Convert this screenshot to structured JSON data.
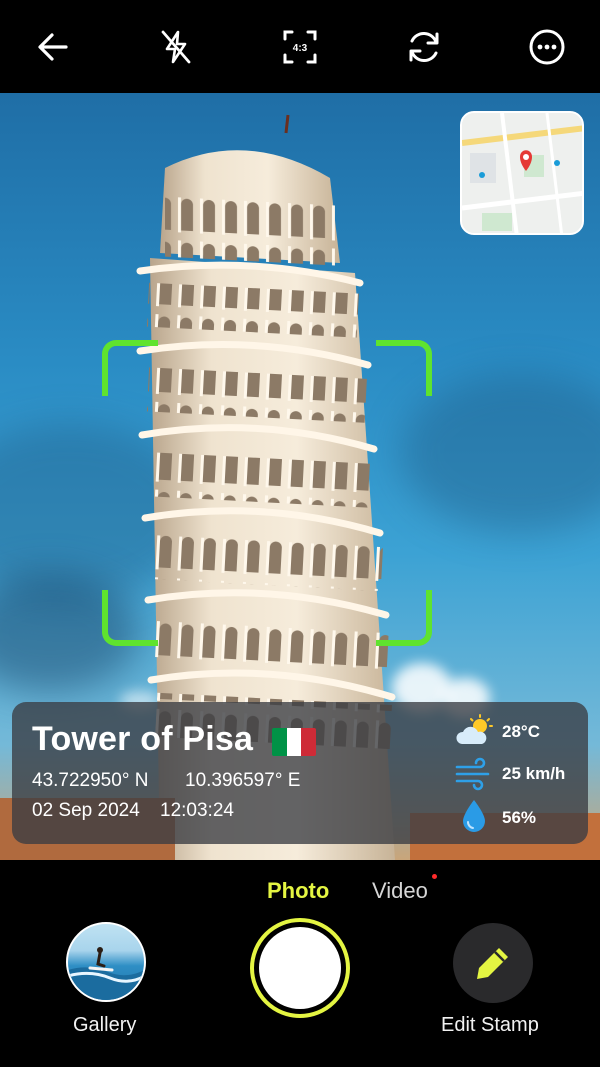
{
  "toolbar": {
    "icons": [
      "back-arrow-icon",
      "flash-off-icon",
      "aspect-ratio-icon",
      "switch-camera-icon",
      "more-options-icon"
    ],
    "aspect_ratio": "4:3"
  },
  "viewfinder": {
    "focus_color": "#5fe32e"
  },
  "stamp": {
    "place": "Tower of Pisa",
    "flag_colors": [
      "#009246",
      "#ffffff",
      "#ce2b37"
    ],
    "latitude": "43.722950° N",
    "longitude": "10.396597° E",
    "date": "02 Sep 2024",
    "time": "12:03:24",
    "weather": {
      "temperature": "28°C",
      "wind": "25 km/h",
      "humidity": "56%"
    }
  },
  "modes": {
    "photo": "Photo",
    "video": "Video",
    "active": "Photo",
    "accent": "#e4f542"
  },
  "controls": {
    "gallery_label": "Gallery",
    "edit_stamp_label": "Edit Stamp"
  }
}
